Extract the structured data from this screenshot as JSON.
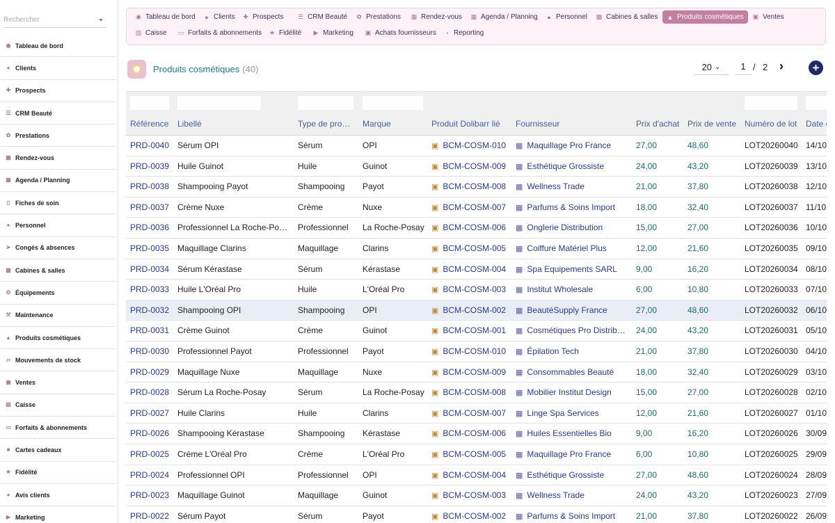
{
  "search": {
    "placeholder": "Rechercher"
  },
  "sidebar": {
    "items": [
      {
        "label": "Tableau de bord",
        "icon": "palette-icon"
      },
      {
        "label": "Clients",
        "icon": "user-icon"
      },
      {
        "label": "Prospects",
        "icon": "user-plus-icon"
      },
      {
        "label": "CRM Beauté",
        "icon": "list-icon"
      },
      {
        "label": "Prestations",
        "icon": "lotus-icon"
      },
      {
        "label": "Rendez-vous",
        "icon": "calendar-check-icon"
      },
      {
        "label": "Agenda / Planning",
        "icon": "calendar-icon"
      },
      {
        "label": "Fiches de soin",
        "icon": "file-icon"
      },
      {
        "label": "Personnel",
        "icon": "user-tie-icon"
      },
      {
        "label": "Congés & absences",
        "icon": "plane-icon"
      },
      {
        "label": "Cabines & salles",
        "icon": "couch-icon"
      },
      {
        "label": "Équipements",
        "icon": "gears-icon"
      },
      {
        "label": "Maintenance",
        "icon": "wrench-icon"
      },
      {
        "label": "Produits cosmétiques",
        "icon": "pump-bottle-icon"
      },
      {
        "label": "Mouvements de stock",
        "icon": "dolly-icon"
      },
      {
        "label": "Ventes",
        "icon": "bag-icon"
      },
      {
        "label": "Caisse",
        "icon": "cash-register-icon"
      },
      {
        "label": "Forfaits & abonnements",
        "icon": "ticket-icon"
      },
      {
        "label": "Cartes cadeaux",
        "icon": "gift-icon"
      },
      {
        "label": "Fidélité",
        "icon": "star-icon"
      },
      {
        "label": "Avis clients",
        "icon": "comment-icon"
      },
      {
        "label": "Marketing",
        "icon": "bullhorn-icon"
      }
    ]
  },
  "topnav": {
    "items": [
      {
        "label": "Tableau de bord"
      },
      {
        "label": "Clients"
      },
      {
        "label": "Prospects"
      },
      {
        "label": "CRM Beauté"
      },
      {
        "label": "Prestations"
      },
      {
        "label": "Rendez-vous"
      },
      {
        "label": "Agenda / Planning"
      },
      {
        "label": "Personnel"
      },
      {
        "label": "Cabines & salles"
      },
      {
        "label": "Produits cosmétiques",
        "active": true
      },
      {
        "label": "Ventes"
      },
      {
        "label": "Caisse"
      },
      {
        "label": "Forfaits & abonnements"
      },
      {
        "label": "Fidélité"
      },
      {
        "label": "Marketing"
      },
      {
        "label": "Achats fournisseurs"
      },
      {
        "label": "Reporting"
      }
    ]
  },
  "header": {
    "title": "Produits cosmétiques",
    "count": "(40)"
  },
  "pagination": {
    "per_page": "20",
    "current": "1",
    "separator": "/",
    "total": "2"
  },
  "table": {
    "columns": [
      "Référence",
      "Libellé",
      "Type de pro…",
      "Marque",
      "Produit Dolibarr lié",
      "Fournisseur",
      "Prix d'achat",
      "Prix de vente",
      "Numéro de lot",
      "Date d"
    ],
    "rows": [
      [
        "PRD-0040",
        "Sérum OPI",
        "Sérum",
        "OPI",
        "BCM-COSM-010",
        "Maquillage Pro France",
        "27,00",
        "48,60",
        "LOT20260040",
        "14/10"
      ],
      [
        "PRD-0039",
        "Huile Guinot",
        "Huile",
        "Guinot",
        "BCM-COSM-009",
        "Esthétique Grossiste",
        "24,00",
        "43,20",
        "LOT20260039",
        "13/10"
      ],
      [
        "PRD-0038",
        "Shampooing Payot",
        "Shampooing",
        "Payot",
        "BCM-COSM-008",
        "Wellness Trade",
        "21,00",
        "37,80",
        "LOT20260038",
        "12/10"
      ],
      [
        "PRD-0037",
        "Crème Nuxe",
        "Crème",
        "Nuxe",
        "BCM-COSM-007",
        "Parfums & Soins Import",
        "18,00",
        "32,40",
        "LOT20260037",
        "11/10"
      ],
      [
        "PRD-0036",
        "Professionnel La Roche-Po…",
        "Professionnel",
        "La Roche-Posay",
        "BCM-COSM-006",
        "Onglerie Distribution",
        "15,00",
        "27,00",
        "LOT20260036",
        "10/10"
      ],
      [
        "PRD-0035",
        "Maquillage Clarins",
        "Maquillage",
        "Clarins",
        "BCM-COSM-005",
        "Coiffure Matériel Plus",
        "12,00",
        "21,60",
        "LOT20260035",
        "09/10"
      ],
      [
        "PRD-0034",
        "Sérum Kérastase",
        "Sérum",
        "Kérastase",
        "BCM-COSM-004",
        "Spa Equipements SARL",
        "9,00",
        "16,20",
        "LOT20260034",
        "08/10"
      ],
      [
        "PRD-0033",
        "Huile L'Oréal Pro",
        "Huile",
        "L'Oréal Pro",
        "BCM-COSM-003",
        "Institut Wholesale",
        "6,00",
        "10,80",
        "LOT20260033",
        "07/10"
      ],
      [
        "PRD-0032",
        "Shampooing OPI",
        "Shampooing",
        "OPI",
        "BCM-COSM-002",
        "BeautéSupply France",
        "27,00",
        "48,60",
        "LOT20260032",
        "06/10"
      ],
      [
        "PRD-0031",
        "Crème Guinot",
        "Crème",
        "Guinot",
        "BCM-COSM-001",
        "Cosmétiques Pro Distrib…",
        "24,00",
        "43,20",
        "LOT20260031",
        "05/10"
      ],
      [
        "PRD-0030",
        "Professionnel Payot",
        "Professionnel",
        "Payot",
        "BCM-COSM-010",
        "Épilation Tech",
        "21,00",
        "37,80",
        "LOT20260030",
        "04/10"
      ],
      [
        "PRD-0029",
        "Maquillage Nuxe",
        "Maquillage",
        "Nuxe",
        "BCM-COSM-009",
        "Consommables Beauté",
        "18,00",
        "32,40",
        "LOT20260029",
        "03/10"
      ],
      [
        "PRD-0028",
        "Sérum La Roche-Posay",
        "Sérum",
        "La Roche-Posay",
        "BCM-COSM-008",
        "Mobilier Institut Design",
        "15,00",
        "27,00",
        "LOT20260028",
        "02/10"
      ],
      [
        "PRD-0027",
        "Huile Clarins",
        "Huile",
        "Clarins",
        "BCM-COSM-007",
        "Linge Spa Services",
        "12,00",
        "21,60",
        "LOT20260027",
        "01/10"
      ],
      [
        "PRD-0026",
        "Shampooing Kérastase",
        "Shampooing",
        "Kérastase",
        "BCM-COSM-006",
        "Huiles Essentielles Bio",
        "9,00",
        "16,20",
        "LOT20260026",
        "30/09"
      ],
      [
        "PRD-0025",
        "Crème L'Oréal Pro",
        "Crème",
        "L'Oréal Pro",
        "BCM-COSM-005",
        "Maquillage Pro France",
        "6,00",
        "10,80",
        "LOT20260025",
        "29/09"
      ],
      [
        "PRD-0024",
        "Professionnel OPI",
        "Professionnel",
        "OPI",
        "BCM-COSM-004",
        "Esthétique Grossiste",
        "27,00",
        "48,60",
        "LOT20260024",
        "28/09"
      ],
      [
        "PRD-0023",
        "Maquillage Guinot",
        "Maquillage",
        "Guinot",
        "BCM-COSM-003",
        "Wellness Trade",
        "24,00",
        "43,20",
        "LOT20260023",
        "27/09"
      ],
      [
        "PRD-0022",
        "Sérum Payot",
        "Sérum",
        "Payot",
        "BCM-COSM-002",
        "Parfums & Soins Import",
        "21,00",
        "37,80",
        "LOT20260022",
        "26/09"
      ]
    ],
    "highlighted_row": "PRD-0032"
  },
  "colors": {
    "accent": "#c27fa2",
    "link": "#283a8c",
    "price": "#1d6b6b",
    "header_text": "#435ea4"
  }
}
